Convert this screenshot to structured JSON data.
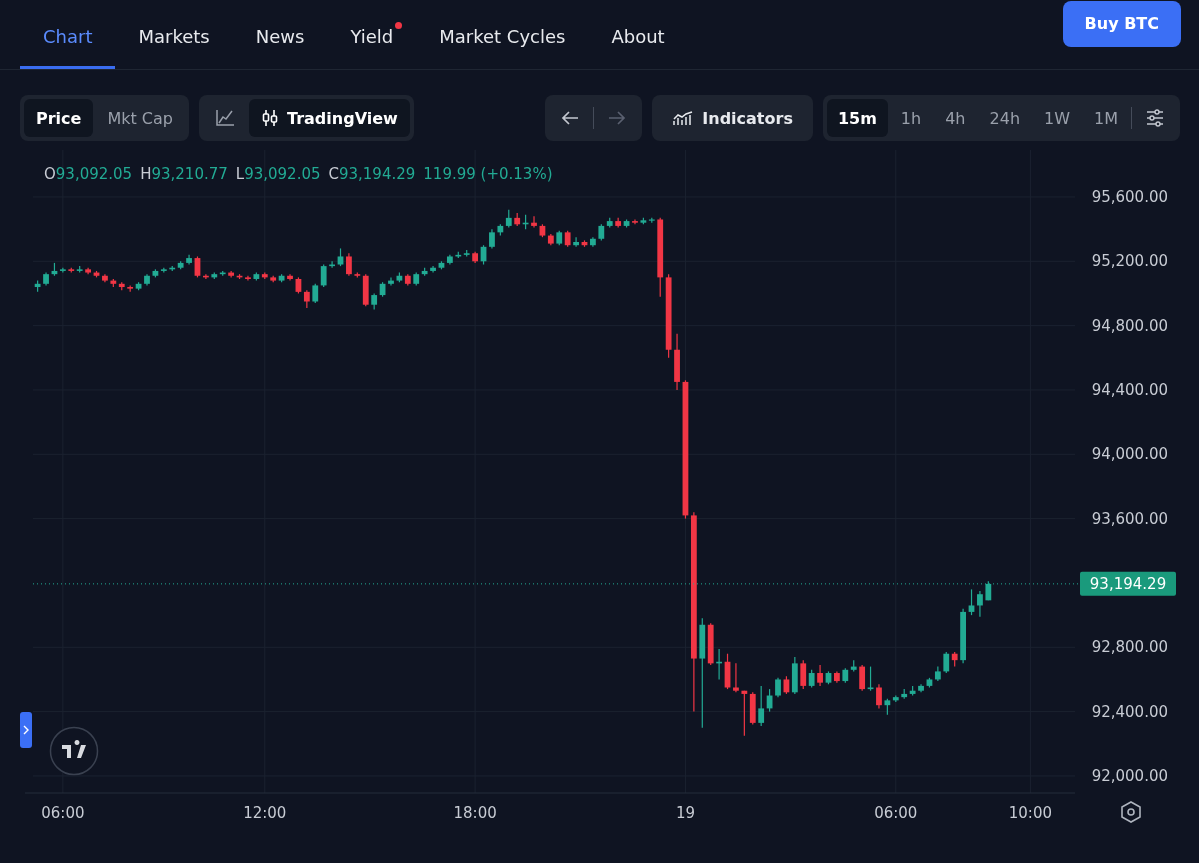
{
  "nav": {
    "tabs": [
      {
        "label": "Chart",
        "selected": true,
        "badge": false
      },
      {
        "label": "Markets",
        "selected": false,
        "badge": false
      },
      {
        "label": "News",
        "selected": false,
        "badge": false
      },
      {
        "label": "Yield",
        "selected": false,
        "badge": true
      },
      {
        "label": "Market Cycles",
        "selected": false,
        "badge": false
      },
      {
        "label": "About",
        "selected": false,
        "badge": false
      }
    ],
    "cta": "Buy BTC"
  },
  "toolbar": {
    "metric": [
      {
        "label": "Price",
        "selected": true
      },
      {
        "label": "Mkt Cap",
        "selected": false
      }
    ],
    "chart_types": [
      {
        "kind": "line",
        "selected": false
      },
      {
        "kind": "candles",
        "label": "TradingView",
        "selected": true
      }
    ],
    "history": [
      {
        "kind": "back",
        "disabled": false
      },
      {
        "kind": "forward",
        "disabled": true
      }
    ],
    "indicators": "Indicators",
    "intervals": [
      {
        "label": "15m",
        "selected": true
      },
      {
        "label": "1h",
        "selected": false
      },
      {
        "label": "4h",
        "selected": false
      },
      {
        "label": "24h",
        "selected": false
      },
      {
        "label": "1W",
        "selected": false
      },
      {
        "label": "1M",
        "selected": false
      }
    ]
  },
  "legend": {
    "ohlc": [
      {
        "key": "O",
        "value": "93,092.05"
      },
      {
        "key": "H",
        "value": "93,210.77"
      },
      {
        "key": "L",
        "value": "93,092.05"
      },
      {
        "key": "C",
        "value": "93,194.29"
      }
    ],
    "change": "119.99 (+0.13%)"
  },
  "chart": {
    "chart_data": {
      "type": "candlestick",
      "grid": true,
      "ylim": [
        91894,
        95892
      ],
      "yticks": [
        {
          "value": 95600,
          "label": "95,600.00"
        },
        {
          "value": 95200,
          "label": "95,200.00"
        },
        {
          "value": 94800,
          "label": "94,800.00"
        },
        {
          "value": 94400,
          "label": "94,400.00"
        },
        {
          "value": 94000,
          "label": "94,000.00"
        },
        {
          "value": 93600,
          "label": "93,600.00"
        },
        {
          "value": 92800,
          "label": "92,800.00"
        },
        {
          "value": 92400,
          "label": "92,400.00"
        },
        {
          "value": 92000,
          "label": "92,000.00"
        }
      ],
      "categories": [
        null,
        null,
        null,
        "06:00",
        null,
        null,
        null,
        null,
        null,
        null,
        null,
        null,
        null,
        null,
        null,
        null,
        null,
        null,
        null,
        null,
        null,
        null,
        null,
        null,
        null,
        null,
        null,
        "12:00",
        null,
        null,
        null,
        null,
        null,
        null,
        null,
        null,
        null,
        null,
        null,
        null,
        null,
        null,
        null,
        null,
        null,
        null,
        null,
        null,
        null,
        null,
        null,
        null,
        "18:00",
        null,
        null,
        null,
        null,
        null,
        null,
        null,
        null,
        null,
        null,
        null,
        null,
        null,
        null,
        null,
        null,
        null,
        null,
        null,
        null,
        null,
        null,
        null,
        null,
        "19",
        null,
        null,
        null,
        null,
        null,
        null,
        null,
        null,
        null,
        null,
        null,
        null,
        null,
        null,
        null,
        null,
        null,
        null,
        null,
        null,
        null,
        null,
        null,
        null,
        "06:00",
        null,
        null,
        null,
        null,
        null,
        null,
        null,
        null,
        null,
        null,
        null,
        null,
        null,
        null,
        null,
        "10:00"
      ],
      "ohlc": [
        [
          95040,
          95080,
          95010,
          95060
        ],
        [
          95060,
          95130,
          95050,
          95120
        ],
        [
          95120,
          95190,
          95110,
          95140
        ],
        [
          95140,
          95160,
          95130,
          95150
        ],
        [
          95150,
          95160,
          95130,
          95140
        ],
        [
          95140,
          95170,
          95130,
          95150
        ],
        [
          95150,
          95160,
          95120,
          95130
        ],
        [
          95130,
          95140,
          95100,
          95110
        ],
        [
          95110,
          95120,
          95070,
          95080
        ],
        [
          95080,
          95090,
          95040,
          95060
        ],
        [
          95060,
          95070,
          95020,
          95040
        ],
        [
          95040,
          95050,
          95010,
          95030
        ],
        [
          95030,
          95070,
          95020,
          95060
        ],
        [
          95060,
          95120,
          95050,
          95110
        ],
        [
          95110,
          95150,
          95100,
          95140
        ],
        [
          95140,
          95160,
          95130,
          95150
        ],
        [
          95150,
          95170,
          95140,
          95160
        ],
        [
          95160,
          95200,
          95150,
          95190
        ],
        [
          95190,
          95240,
          95180,
          95220
        ],
        [
          95220,
          95230,
          95100,
          95110
        ],
        [
          95110,
          95120,
          95090,
          95100
        ],
        [
          95100,
          95130,
          95090,
          95120
        ],
        [
          95120,
          95140,
          95110,
          95130
        ],
        [
          95130,
          95140,
          95100,
          95110
        ],
        [
          95110,
          95120,
          95090,
          95100
        ],
        [
          95100,
          95110,
          95080,
          95090
        ],
        [
          95090,
          95130,
          95080,
          95120
        ],
        [
          95120,
          95130,
          95090,
          95100
        ],
        [
          95100,
          95110,
          95070,
          95080
        ],
        [
          95080,
          95120,
          95070,
          95110
        ],
        [
          95110,
          95120,
          95080,
          95090
        ],
        [
          95090,
          95100,
          95000,
          95010
        ],
        [
          95010,
          95020,
          94910,
          94950
        ],
        [
          94950,
          95060,
          94940,
          95050
        ],
        [
          95050,
          95180,
          95040,
          95170
        ],
        [
          95170,
          95200,
          95160,
          95180
        ],
        [
          95180,
          95280,
          95170,
          95230
        ],
        [
          95230,
          95250,
          95110,
          95120
        ],
        [
          95120,
          95130,
          95100,
          95110
        ],
        [
          95110,
          95120,
          94920,
          94930
        ],
        [
          94930,
          95000,
          94900,
          94990
        ],
        [
          94990,
          95070,
          94980,
          95060
        ],
        [
          95060,
          95100,
          95050,
          95080
        ],
        [
          95080,
          95130,
          95070,
          95110
        ],
        [
          95110,
          95120,
          95050,
          95060
        ],
        [
          95060,
          95130,
          95050,
          95120
        ],
        [
          95120,
          95160,
          95110,
          95140
        ],
        [
          95140,
          95170,
          95130,
          95160
        ],
        [
          95160,
          95200,
          95150,
          95190
        ],
        [
          95190,
          95240,
          95180,
          95230
        ],
        [
          95230,
          95260,
          95220,
          95240
        ],
        [
          95240,
          95270,
          95230,
          95250
        ],
        [
          95250,
          95260,
          95190,
          95200
        ],
        [
          95200,
          95300,
          95180,
          95290
        ],
        [
          95290,
          95400,
          95280,
          95380
        ],
        [
          95380,
          95430,
          95360,
          95420
        ],
        [
          95420,
          95520,
          95410,
          95470
        ],
        [
          95470,
          95500,
          95420,
          95430
        ],
        [
          95430,
          95490,
          95400,
          95440
        ],
        [
          95440,
          95480,
          95410,
          95420
        ],
        [
          95420,
          95430,
          95350,
          95360
        ],
        [
          95360,
          95370,
          95300,
          95310
        ],
        [
          95310,
          95390,
          95300,
          95380
        ],
        [
          95380,
          95390,
          95290,
          95300
        ],
        [
          95300,
          95350,
          95290,
          95320
        ],
        [
          95320,
          95330,
          95290,
          95300
        ],
        [
          95300,
          95350,
          95290,
          95340
        ],
        [
          95340,
          95430,
          95330,
          95420
        ],
        [
          95420,
          95470,
          95410,
          95450
        ],
        [
          95450,
          95470,
          95410,
          95420
        ],
        [
          95420,
          95460,
          95410,
          95450
        ],
        [
          95450,
          95460,
          95430,
          95440
        ],
        [
          95440,
          95470,
          95430,
          95455
        ],
        [
          95455,
          95470,
          95440,
          95460
        ],
        [
          95460,
          95470,
          94980,
          95100
        ],
        [
          95100,
          95120,
          94600,
          94650
        ],
        [
          94650,
          94750,
          94400,
          94450
        ],
        [
          94450,
          94460,
          93600,
          93620
        ],
        [
          93620,
          93640,
          92400,
          92730
        ],
        [
          92730,
          92980,
          92300,
          92940
        ],
        [
          92940,
          92950,
          92690,
          92700
        ],
        [
          92700,
          92790,
          92600,
          92710
        ],
        [
          92710,
          92760,
          92540,
          92550
        ],
        [
          92550,
          92700,
          92520,
          92530
        ],
        [
          92530,
          92530,
          92250,
          92510
        ],
        [
          92510,
          92520,
          92320,
          92330
        ],
        [
          92330,
          92560,
          92310,
          92420
        ],
        [
          92420,
          92540,
          92400,
          92500
        ],
        [
          92500,
          92610,
          92490,
          92600
        ],
        [
          92600,
          92620,
          92510,
          92520
        ],
        [
          92520,
          92740,
          92510,
          92700
        ],
        [
          92700,
          92720,
          92540,
          92560
        ],
        [
          92560,
          92660,
          92550,
          92640
        ],
        [
          92640,
          92690,
          92560,
          92580
        ],
        [
          92580,
          92650,
          92570,
          92640
        ],
        [
          92640,
          92650,
          92580,
          92590
        ],
        [
          92590,
          92670,
          92580,
          92660
        ],
        [
          92660,
          92720,
          92650,
          92680
        ],
        [
          92680,
          92690,
          92530,
          92540
        ],
        [
          92540,
          92680,
          92530,
          92550
        ],
        [
          92550,
          92570,
          92420,
          92440
        ],
        [
          92440,
          92480,
          92380,
          92470
        ],
        [
          92470,
          92500,
          92460,
          92490
        ],
        [
          92490,
          92540,
          92480,
          92510
        ],
        [
          92510,
          92560,
          92500,
          92530
        ],
        [
          92530,
          92570,
          92520,
          92560
        ],
        [
          92560,
          92610,
          92550,
          92600
        ],
        [
          92600,
          92680,
          92590,
          92650
        ],
        [
          92650,
          92770,
          92640,
          92760
        ],
        [
          92760,
          92770,
          92680,
          92720
        ],
        [
          92720,
          93040,
          92700,
          93020
        ],
        [
          93020,
          93160,
          93000,
          93060
        ],
        [
          93060,
          93150,
          92990,
          93130
        ],
        [
          93092,
          93211,
          93092,
          93194
        ],
        null,
        null,
        null,
        null,
        null
      ],
      "ref_lines": [
        {
          "axis": "y",
          "value": 93194.29,
          "label": "93,194.29"
        }
      ]
    }
  }
}
